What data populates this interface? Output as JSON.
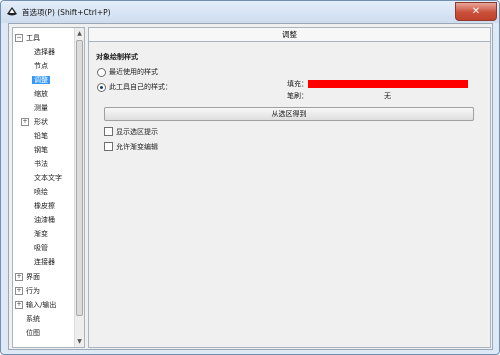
{
  "window": {
    "title": "首选项(P) (Shift+Ctrl+P)",
    "close_glyph": "✕"
  },
  "tree": {
    "items": [
      {
        "label": "工具",
        "expander": "⊟"
      },
      {
        "label": "选择器"
      },
      {
        "label": "节点"
      },
      {
        "label": "调整",
        "selected": true
      },
      {
        "label": "缩放"
      },
      {
        "label": "测量"
      },
      {
        "label": "形状",
        "expander": "⊞"
      },
      {
        "label": "铅笔"
      },
      {
        "label": "钢笔"
      },
      {
        "label": "书法"
      },
      {
        "label": "文本文字"
      },
      {
        "label": "喷绘"
      },
      {
        "label": "橡皮擦"
      },
      {
        "label": "油漆桶"
      },
      {
        "label": "渐变"
      },
      {
        "label": "吸管"
      },
      {
        "label": "连接器"
      },
      {
        "label": "界面",
        "expander": "⊞"
      },
      {
        "label": "行为",
        "expander": "⊞"
      },
      {
        "label": "输入/输出",
        "expander": "⊞"
      },
      {
        "label": "系统"
      },
      {
        "label": "位图"
      }
    ],
    "scroll_up": "▲",
    "scroll_down": "▼"
  },
  "panel": {
    "header": "调整",
    "section_title": "对象绘制样式",
    "radio_last_used": "最近使用的样式",
    "radio_own_style": "此工具自己的样式：",
    "fill_label": "填充：",
    "stroke_label": "笔刷：",
    "stroke_value": "无",
    "grab_button": "从选区得到",
    "checkbox_show_selection_cue": "显示选区提示",
    "checkbox_allow_gradient_edit": "允许渐变编辑"
  },
  "colors": {
    "fill": "#ff0000",
    "selection": "#3399ff"
  }
}
